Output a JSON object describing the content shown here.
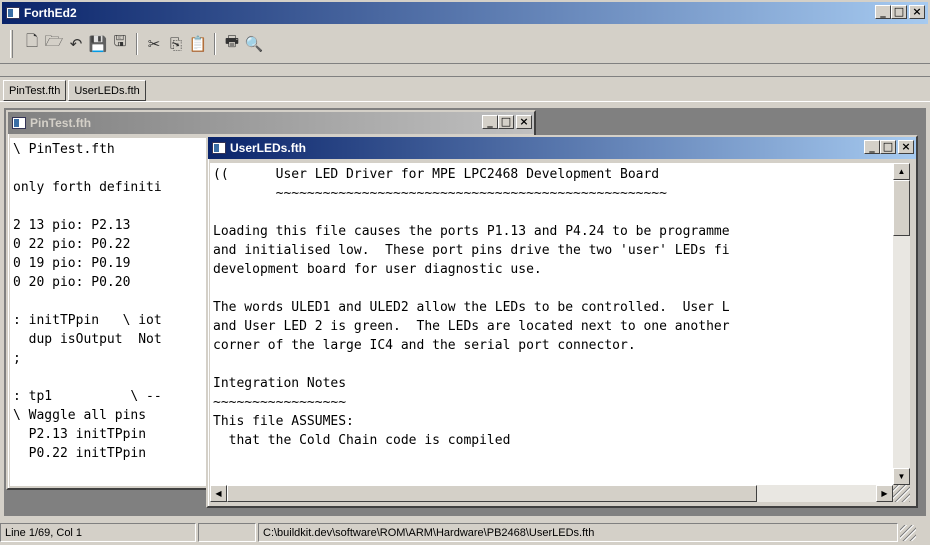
{
  "app": {
    "title": "ForthEd2",
    "icon": "app-icon"
  },
  "toolbar": {
    "buttons": [
      {
        "name": "new-file-icon",
        "glyph": "🗋"
      },
      {
        "name": "open-file-icon",
        "glyph": "🗁"
      },
      {
        "name": "reopen-icon",
        "glyph": "↶"
      },
      {
        "name": "save-icon",
        "glyph": "💾"
      },
      {
        "name": "save-all-icon",
        "glyph": "🖫"
      },
      {
        "name": "cut-icon",
        "glyph": "✂"
      },
      {
        "name": "copy-icon",
        "glyph": "⎘"
      },
      {
        "name": "paste-icon",
        "glyph": "📋"
      },
      {
        "name": "print-icon",
        "glyph": "🖶"
      },
      {
        "name": "find-icon",
        "glyph": "🔍"
      }
    ]
  },
  "tabs": [
    {
      "label": "PinTest.fth"
    },
    {
      "label": "UserLEDs.fth"
    }
  ],
  "pintest": {
    "title": "PinTest.fth",
    "lines": [
      "\\ PinTest.fth",
      "",
      "only forth definiti",
      "",
      "2 13 pio: P2.13",
      "0 22 pio: P0.22",
      "0 19 pio: P0.19",
      "0 20 pio: P0.20",
      "",
      ": initTPpin   \\ iot",
      "  dup isOutput  Not",
      ";",
      "",
      ": tp1          \\ --",
      "\\ Waggle all pins",
      "  P2.13 initTPpin",
      "  P0.22 initTPpin"
    ]
  },
  "userleds": {
    "title": "UserLEDs.fth",
    "lines": [
      "((      User LED Driver for MPE LPC2468 Development Board",
      "        ~~~~~~~~~~~~~~~~~~~~~~~~~~~~~~~~~~~~~~~~~~~~~~~~~~",
      "",
      "Loading this file causes the ports P1.13 and P4.24 to be programme",
      "and initialised low.  These port pins drive the two 'user' LEDs fi",
      "development board for user diagnostic use.",
      "",
      "The words ULED1 and ULED2 allow the LEDs to be controlled.  User L",
      "and User LED 2 is green.  The LEDs are located next to one another",
      "corner of the large IC4 and the serial port connector.",
      "",
      "Integration Notes",
      "~~~~~~~~~~~~~~~~~",
      "This file ASSUMES:",
      "  that the Cold Chain code is compiled"
    ]
  },
  "window_buttons": {
    "minimize": "_",
    "maximize": "□",
    "close": "×"
  },
  "statusbar": {
    "position": "Line 1/69, Col 1",
    "mode": "",
    "path": "C:\\buildkit.dev\\software\\ROM\\ARM\\Hardware\\PB2468\\UserLEDs.fth"
  }
}
